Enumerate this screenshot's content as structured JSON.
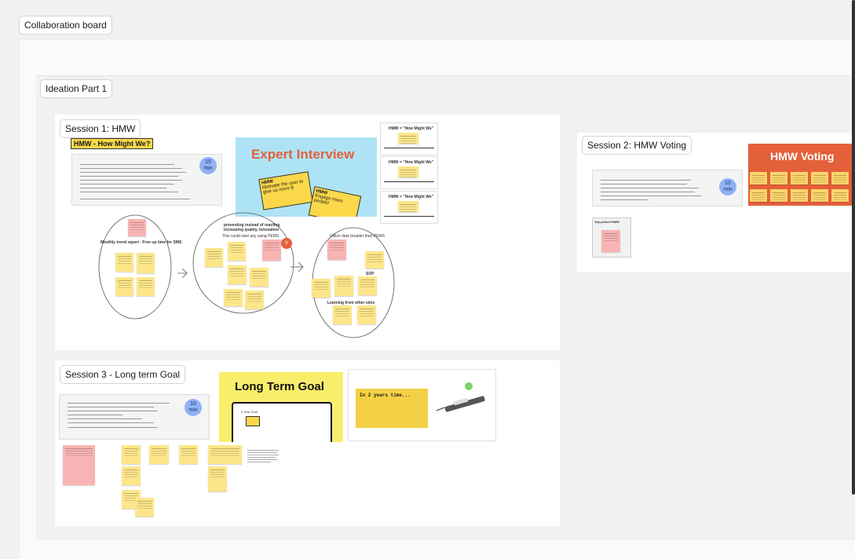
{
  "board": {
    "title": "Collaboration board"
  },
  "section": {
    "title": "Ideation Part 1"
  },
  "session1": {
    "title": "Session 1: HMW",
    "heading": "HMW - How Might We?",
    "timer": {
      "value": "15",
      "unit": "min"
    },
    "expert_card": {
      "title": "Expert Interview",
      "note1": {
        "tag": "HMW",
        "text": "Motivate the user to give us more $"
      },
      "note2": {
        "tag": "HMW",
        "text": "Engage more people!"
      }
    },
    "hmw_cards": [
      {
        "title": "HMW = \"How Might We\""
      },
      {
        "title": "HMW = \"How Might We\""
      },
      {
        "title": "HMW = \"How Might We\""
      }
    ],
    "clusters": [
      {
        "title": "Monthly trend report - Free up time for SMS"
      },
      {
        "title": "preventing instead of reacting increasing quality, innovation",
        "subtitle": "This could start any using PEMS"
      },
      {
        "title": "Utilize data broader than PEMS",
        "sub1": "SOP",
        "sub2": "Learning from other sites"
      }
    ],
    "vote_badge": "V"
  },
  "session2": {
    "title": "Session 2: HMW Voting",
    "timer": {
      "value": "10",
      "unit": "min"
    },
    "voting_card": {
      "title": "HMW Voting"
    },
    "top_picked": "Top picked HMW"
  },
  "session3": {
    "title": "Session 3 - Long term Goal",
    "timer": {
      "value": "10",
      "unit": "min"
    },
    "ltg_card": {
      "title": "Long Term Goal",
      "note": "2 Year Goal"
    },
    "years_note": "In 2 years time..."
  },
  "colors": {
    "frame_bg": "#f1f1f1",
    "canvas_bg": "#fafafa",
    "sticky": "#fde68a",
    "pink": "#f8b4b4",
    "orange": "#e4603b",
    "sky": "#aee3f5",
    "yellow": "#f9ee6b",
    "timer": "#8fb3f5"
  }
}
